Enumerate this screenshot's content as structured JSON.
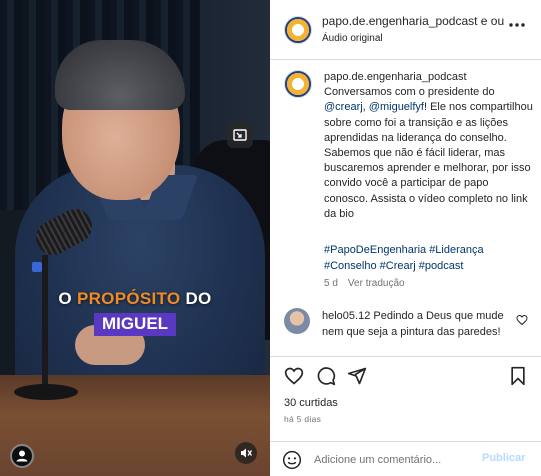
{
  "video": {
    "caption_word_1": "O ",
    "caption_word_2": "PROPÓSITO",
    "caption_word_3": " DO",
    "caption_line_2": "MIGUEL",
    "highlight_color": "#f08a24",
    "name_box_color": "#5b38c2"
  },
  "header": {
    "username": "papo.de.engenharia_podcast e outra",
    "subtitle": "Áudio original",
    "more_icon": "more-horizontal-icon"
  },
  "post": {
    "username": "papo.de.engenharia_podcast",
    "text_before_mention": "Conversamos com o presidente do",
    "mention_1": "@crearj",
    "mention_sep": ", ",
    "mention_2": "@miguelfyf",
    "text_after_mention": "! Ele nos compartilhou sobre como foi a transição e as lições aprendidas na liderança do conselho. Sabemos que não é fácil liderar, mas buscaremos aprender e melhorar, por isso convido você a participar de papo conosco. Assista o vídeo completo no link da bio",
    "hashtags_line_1": "#PapoDeEngenharia #Liderança",
    "hashtags_line_2": "#Conselho #Crearj #podcast",
    "time": "5 d",
    "translate_label": "Ver tradução"
  },
  "comment": {
    "username": "helo05.12",
    "text": "Pedindo a Deus que mude nem que seja a pintura das paredes!"
  },
  "actions": {
    "likes": "30 curtidas",
    "ago": "há 5 dias"
  },
  "input": {
    "placeholder": "Adicione um comentário...",
    "post_label": "Publicar"
  }
}
